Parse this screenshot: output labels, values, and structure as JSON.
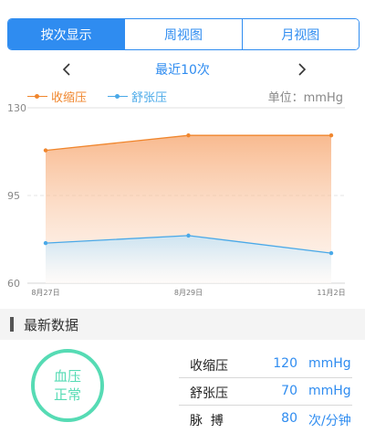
{
  "tabs": [
    {
      "label": "按次显示",
      "active": true
    },
    {
      "label": "周视图",
      "active": false
    },
    {
      "label": "月视图",
      "active": false
    }
  ],
  "nav": {
    "title": "最近10次"
  },
  "legend": {
    "systolic": "收缩压",
    "diastolic": "舒张压",
    "unit": "单位：mmHg"
  },
  "colors": {
    "accent": "#2f8cf0",
    "systolic": "#f0862d",
    "diastolic": "#4aa9e8",
    "status": "#56dbb4"
  },
  "chart_data": {
    "type": "area",
    "x": [
      "8月27日",
      "8月29日",
      "11月2日"
    ],
    "series": [
      {
        "name": "收缩压",
        "values": [
          113,
          119,
          119
        ]
      },
      {
        "name": "舒张压",
        "values": [
          76,
          79,
          72
        ]
      }
    ],
    "ylim": [
      60,
      130
    ],
    "yticks": [
      130,
      95,
      60
    ],
    "grid": "dashed at 95",
    "legend_position": "top-left"
  },
  "latest": {
    "title": "最新数据",
    "status_line1": "血压",
    "status_line2": "正常",
    "rows": [
      {
        "label": "收缩压",
        "value": "120",
        "unit": "mmHg"
      },
      {
        "label": "舒张压",
        "value": "70",
        "unit": "mmHg"
      },
      {
        "label": "脉  搏",
        "value": "80",
        "unit": "次/分钟"
      }
    ]
  }
}
